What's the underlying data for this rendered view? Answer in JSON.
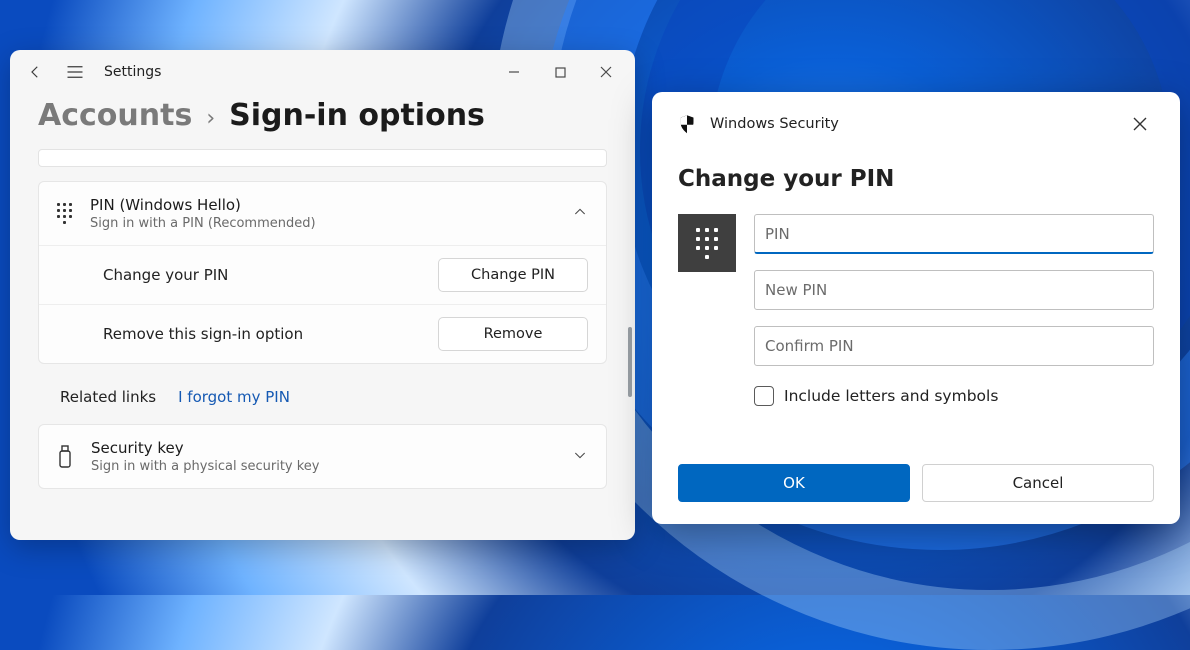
{
  "settings": {
    "app_title": "Settings",
    "breadcrumb": {
      "parent": "Accounts",
      "current": "Sign-in options"
    },
    "pin_section": {
      "title": "PIN (Windows Hello)",
      "subtitle": "Sign in with a PIN (Recommended)",
      "rows": {
        "change": {
          "label": "Change your PIN",
          "button": "Change PIN"
        },
        "remove": {
          "label": "Remove this sign-in option",
          "button": "Remove"
        }
      }
    },
    "related": {
      "header": "Related links",
      "forgot": "I forgot my PIN"
    },
    "security_key": {
      "title": "Security key",
      "subtitle": "Sign in with a physical security key"
    }
  },
  "dialog": {
    "window_title": "Windows Security",
    "heading": "Change your PIN",
    "fields": {
      "pin": "PIN",
      "new_pin": "New PIN",
      "confirm_pin": "Confirm PIN"
    },
    "checkbox": "Include letters and symbols",
    "actions": {
      "ok": "OK",
      "cancel": "Cancel"
    }
  }
}
